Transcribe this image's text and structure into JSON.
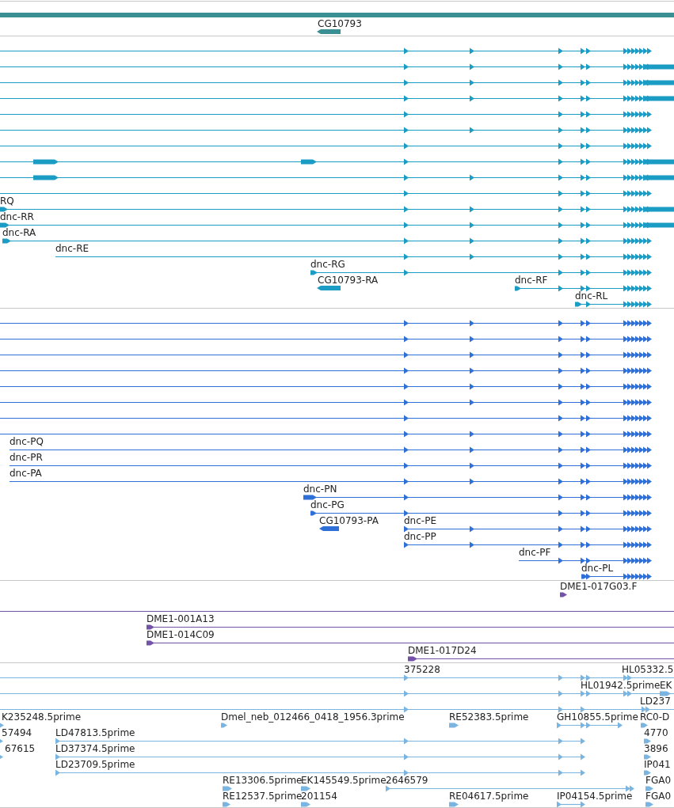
{
  "tracks": [
    {
      "color": "#3a8f94",
      "features": [
        {
          "kind": "span"
        },
        {
          "kind": "gene",
          "label": "CG10793"
        }
      ]
    },
    {
      "color": "#1a9cc4",
      "features": [
        {
          "kind": "transcript"
        },
        {
          "kind": "transcript"
        },
        {
          "kind": "transcript"
        },
        {
          "kind": "transcript"
        },
        {
          "kind": "transcript"
        },
        {
          "kind": "transcript"
        },
        {
          "kind": "transcript"
        },
        {
          "kind": "transcript"
        },
        {
          "kind": "transcript"
        },
        {
          "kind": "transcript"
        },
        {
          "kind": "transcript",
          "label": "RQ"
        },
        {
          "kind": "transcript",
          "label": "dnc-RR"
        },
        {
          "kind": "transcript",
          "label": "dnc-RA"
        },
        {
          "kind": "transcript",
          "label": "dnc-RE"
        },
        {
          "kind": "transcript",
          "label": "dnc-RG"
        },
        {
          "kind": "gene",
          "label": "CG10793-RA"
        },
        {
          "kind": "transcript",
          "label": "dnc-RF"
        },
        {
          "kind": "transcript",
          "label": "dnc-RL"
        }
      ]
    },
    {
      "color": "#2e6fd8",
      "features": [
        {
          "kind": "transcript"
        },
        {
          "kind": "transcript"
        },
        {
          "kind": "transcript"
        },
        {
          "kind": "transcript"
        },
        {
          "kind": "transcript"
        },
        {
          "kind": "transcript"
        },
        {
          "kind": "transcript"
        },
        {
          "kind": "transcript"
        },
        {
          "kind": "transcript",
          "label": "dnc-PQ"
        },
        {
          "kind": "transcript",
          "label": "dnc-PR"
        },
        {
          "kind": "transcript",
          "label": "dnc-PA"
        },
        {
          "kind": "transcript",
          "label": "dnc-PN"
        },
        {
          "kind": "transcript",
          "label": "dnc-PG"
        },
        {
          "kind": "gene",
          "label": "CG10793-PA"
        },
        {
          "kind": "transcript",
          "label": "dnc-PE"
        },
        {
          "kind": "transcript",
          "label": "dnc-PP"
        },
        {
          "kind": "transcript",
          "label": "dnc-PF"
        },
        {
          "kind": "transcript",
          "label": "dnc-PL"
        }
      ]
    },
    {
      "color": "#7452a8",
      "features": [
        {
          "kind": "read",
          "label": "DME1-017G03.F"
        },
        {
          "kind": "read"
        },
        {
          "kind": "read",
          "label": "DME1-001A13"
        },
        {
          "kind": "read",
          "label": "DME1-014C09"
        },
        {
          "kind": "read",
          "label": "DME1-017D24"
        }
      ]
    },
    {
      "color": "#7ab4e0",
      "features": [
        {
          "kind": "read",
          "label": "375228"
        },
        {
          "kind": "read",
          "label": "HL05332.5"
        },
        {
          "kind": "read",
          "label": "HL01942.5prime"
        },
        {
          "kind": "read",
          "label": "EK"
        },
        {
          "kind": "read"
        },
        {
          "kind": "read",
          "label": "LD237"
        },
        {
          "kind": "read",
          "label": "K235248.5prime"
        },
        {
          "kind": "read",
          "label": "Dmel_neb_012466_0418_1956.3prime"
        },
        {
          "kind": "read",
          "label": "RE52383.5prime"
        },
        {
          "kind": "read",
          "label": "GH10855.5prime"
        },
        {
          "kind": "read",
          "label": "RC0-D"
        },
        {
          "kind": "read",
          "label": "57494"
        },
        {
          "kind": "read",
          "label": "LD47813.5prime"
        },
        {
          "kind": "read",
          "label": "4770"
        },
        {
          "kind": "read",
          "label": "67615"
        },
        {
          "kind": "read",
          "label": "LD37374.5prime"
        },
        {
          "kind": "read",
          "label": "3896"
        },
        {
          "kind": "read",
          "label": "LD23709.5prime"
        },
        {
          "kind": "read",
          "label": "IP041"
        },
        {
          "kind": "read",
          "label": "RE13306.5prime"
        },
        {
          "kind": "read",
          "label": "EK145549.5prime"
        },
        {
          "kind": "read",
          "label": "2646579"
        },
        {
          "kind": "read",
          "label": "FGA0"
        },
        {
          "kind": "read",
          "label": "RE12537.5prime"
        },
        {
          "kind": "read",
          "label": "201154"
        },
        {
          "kind": "read",
          "label": "RE04617.5prime"
        },
        {
          "kind": "read",
          "label": "IP04154.5prime"
        },
        {
          "kind": "read",
          "label": "FGA0"
        }
      ]
    }
  ]
}
